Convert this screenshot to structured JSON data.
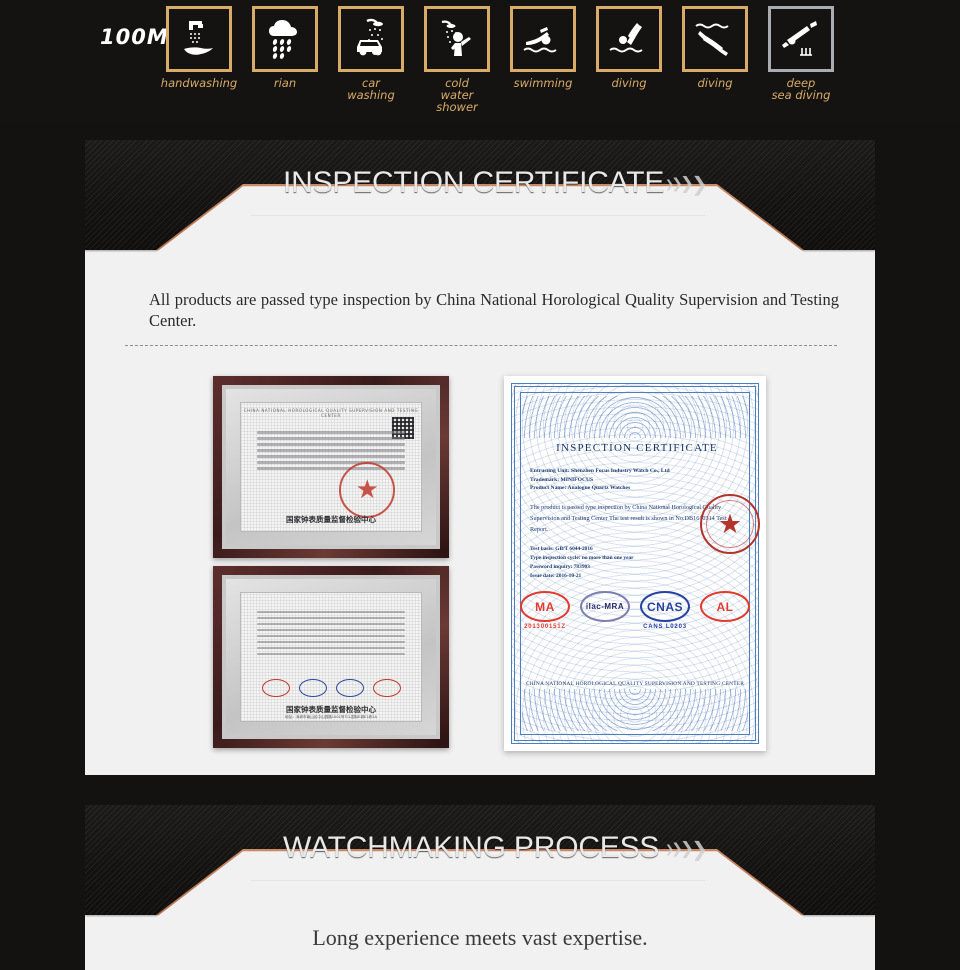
{
  "water_resistance": {
    "rating_label": "100M",
    "items": [
      {
        "icon": "handwashing-icon",
        "label": "handwashing",
        "frame": "gold"
      },
      {
        "icon": "rain-cloud-icon",
        "label": "rian",
        "frame": "gold"
      },
      {
        "icon": "car-washing-icon",
        "label": "car\nwashing",
        "frame": "gold"
      },
      {
        "icon": "cold-water-shower-icon",
        "label": "cold\nwater shower",
        "frame": "gold"
      },
      {
        "icon": "swimming-icon",
        "label": "swimming",
        "frame": "gold"
      },
      {
        "icon": "diving-icon",
        "label": "diving",
        "frame": "gold"
      },
      {
        "icon": "diving-deep-icon",
        "label": "diving",
        "frame": "gold"
      },
      {
        "icon": "deep-sea-diving-icon",
        "label": "deep\nsea diving",
        "frame": "silver"
      }
    ]
  },
  "colors": {
    "page_background": "#131211",
    "panel_background": "#f1f1f1",
    "gold_frame": "#d9ab68",
    "silver_frame": "#a9adb2",
    "copper_edge": "#c1825c",
    "banner_dark": "#141311"
  },
  "sections": {
    "inspection": {
      "title": "INSPECTION CERTIFICATE",
      "intro": "All products are passed type inspection by China National Horological Quality Supervision and Testing Center."
    },
    "watchmaking": {
      "title": "WATCHMAKING PROCESS",
      "tagline": "Long experience meets vast expertise."
    }
  },
  "certificate_large": {
    "title": "INSPECTION CERTIFICATE",
    "fields": [
      "Entrusting Unit: Shenzhen Focus Industry Watch Co., Ltd",
      "Trademark: MINIFOCUS",
      "Product Name: Analogue Quartz Watches"
    ],
    "paragraph": "The product is passed type inspection by China National Horological Quality Supervision and Testing Center The test result is shown in No.DB1610314 Test Report.",
    "details": [
      "Test basis: GB/T 6044-2016",
      "Type inspection cycle:  no more than one year",
      "Password inquiry: 783903",
      "Issue date: 2016-10-21"
    ],
    "logos": [
      {
        "name": "cma-logo",
        "mark": "MA",
        "sub": "201300151Z",
        "color": "#e23b2e"
      },
      {
        "name": "ilac-mra-logo",
        "mark": "ilac-MRA",
        "sub": "",
        "color": "#2a2a6a"
      },
      {
        "name": "cnas-logo",
        "mark": "CNAS",
        "sub": "CANS L0203",
        "color": "#2542a0"
      },
      {
        "name": "cal-logo",
        "mark": "AL",
        "sub": "",
        "color": "#e23b2e"
      }
    ],
    "footer": "CHINA NATIONAL HOROLOGICAL QUALITY SUPERVISION AND TESTING CENTER"
  },
  "certificate_photos": [
    {
      "name": "framed-certificate-top",
      "header": "CHINA NATIONAL HOROLOGICAL QUALITY SUPERVISION AND TESTING CENTER",
      "footer": "国家钟表质量监督检验中心",
      "footer_sub": "",
      "has_qr": true,
      "has_seal": true
    },
    {
      "name": "framed-certificate-bottom",
      "header": "",
      "footer": "国家钟表质量监督检验中心",
      "footer_sub": "地址：深圳市南山区中山园路1001号TCL国际E城E1栋2A",
      "has_qr": false,
      "has_seal": false
    }
  ],
  "chevron_glyph": "❯"
}
